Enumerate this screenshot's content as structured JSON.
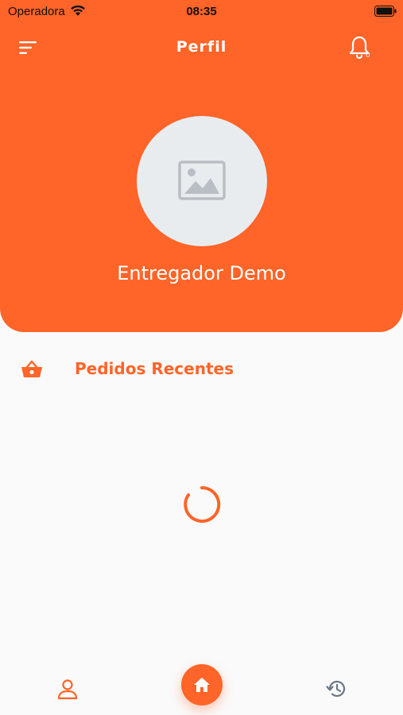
{
  "status_bar": {
    "carrier": "Operadora",
    "time": "08:35"
  },
  "header": {
    "title": "Perfil",
    "notification_count": "0"
  },
  "profile": {
    "name": "Entregador Demo"
  },
  "section": {
    "title": "Pedidos Recentes"
  },
  "colors": {
    "brand": "#ff6428",
    "avatar_bg": "#e9ecef",
    "inactive_icon": "#6b7785"
  },
  "bottom_nav": {
    "items": [
      {
        "icon": "profile-icon",
        "active": true
      },
      {
        "icon": "home-icon",
        "active": false
      },
      {
        "icon": "history-icon",
        "active": false
      }
    ]
  }
}
